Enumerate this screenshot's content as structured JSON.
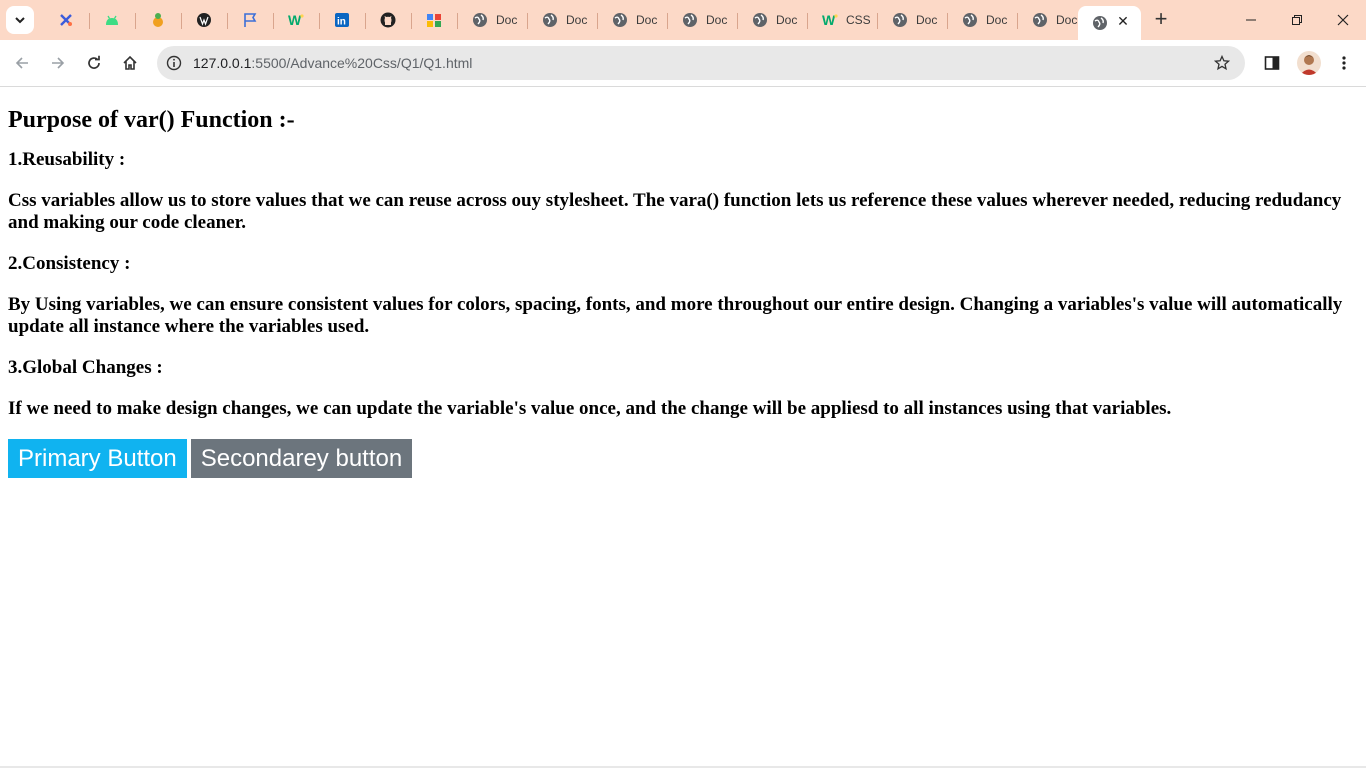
{
  "browser": {
    "tabs": [
      {
        "icon": "tools-icon",
        "title": "",
        "color": "#3b5bdb"
      },
      {
        "icon": "android-icon",
        "title": "",
        "color": "#3ddc84"
      },
      {
        "icon": "snake-icon",
        "title": "",
        "color": "#f0a020"
      },
      {
        "icon": "wordpress-icon",
        "title": "",
        "color": "#21759b"
      },
      {
        "icon": "flag-icon",
        "title": "",
        "color": "#3b6fd8"
      },
      {
        "icon": "w3schools-icon",
        "title": "",
        "color": "#04aa6d"
      },
      {
        "icon": "linkedin-icon",
        "title": "",
        "color": "#0a66c2"
      },
      {
        "icon": "github-icon",
        "title": "",
        "color": "#222222"
      },
      {
        "icon": "apps-icon",
        "title": "",
        "color": "#ea4335"
      },
      {
        "icon": "globe-icon",
        "title": "Doc"
      },
      {
        "icon": "globe-icon",
        "title": "Doc"
      },
      {
        "icon": "globe-icon",
        "title": "Doc"
      },
      {
        "icon": "globe-icon",
        "title": "Doc"
      },
      {
        "icon": "globe-icon",
        "title": "Doc"
      },
      {
        "icon": "w3schools-icon",
        "title": "CSS",
        "color": "#04aa6d"
      },
      {
        "icon": "globe-icon",
        "title": "Doc"
      },
      {
        "icon": "globe-icon",
        "title": "Doc"
      },
      {
        "icon": "globe-icon",
        "title": "Doc"
      }
    ],
    "active_tab": {
      "icon": "globe-icon",
      "close": "✕"
    },
    "new_tab": "+",
    "url_host": "127.0.0.1",
    "url_path": ":5500/Advance%20Css/Q1/Q1.html"
  },
  "page": {
    "heading": "Purpose of var() Function :-",
    "sections": [
      {
        "title": "1.Reusability :",
        "body": "Css variables allow us to store values that we can reuse across ouy stylesheet. The vara() function lets us reference these values wherever needed, reducing redudancy and making our code cleaner."
      },
      {
        "title": "2.Consistency :",
        "body": "By Using variables, we can ensure consistent values for colors, spacing, fonts, and more throughout our entire design. Changing a variables's value will automatically update all instance where the variables used."
      },
      {
        "title": "3.Global Changes :",
        "body": "If we need to make design changes, we can update the variable's value once, and the change will be appliesd to all instances using that variables."
      }
    ],
    "primary_button": "Primary Button",
    "secondary_button": "Secondarey button"
  },
  "colors": {
    "tabstrip": "#fcd9c7",
    "primary": "#10b3f0",
    "secondary": "#6c757d"
  }
}
